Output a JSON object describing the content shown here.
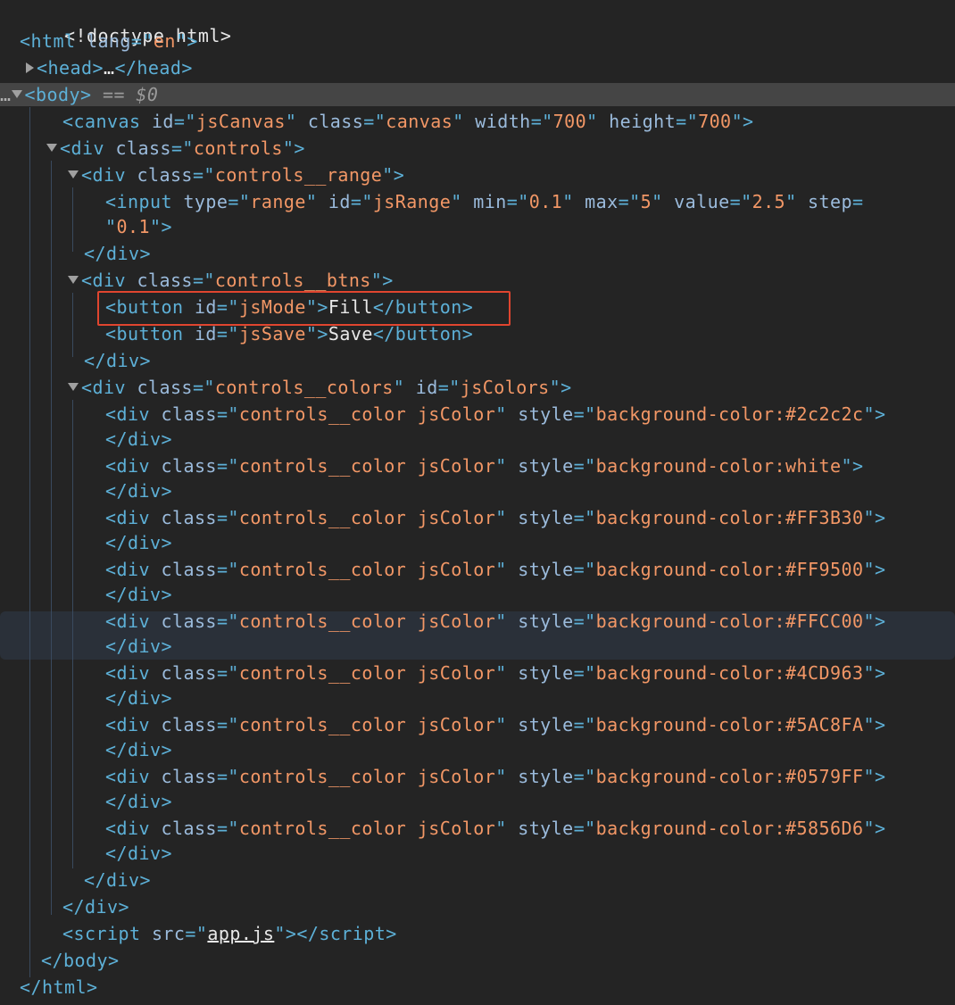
{
  "selected_suffix": "== $0",
  "lines": {
    "doctype": "<!doctype html>",
    "html_lang": "en",
    "head_ellipsis": "…",
    "canvas": {
      "id": "jsCanvas",
      "class": "canvas",
      "width": "700",
      "height": "700"
    },
    "controls_class": "controls",
    "range_class": "controls__range",
    "input": {
      "type": "range",
      "id": "jsRange",
      "min": "0.1",
      "max": "5",
      "value": "2.5",
      "step": "0.1"
    },
    "btns_class": "controls__btns",
    "mode_button": {
      "id": "jsMode",
      "text": "Fill"
    },
    "save_button": {
      "id": "jsSave",
      "text": "Save"
    },
    "colors_div": {
      "class": "controls__colors",
      "id": "jsColors"
    },
    "color_class": "controls__color jsColor",
    "script_src": "app.js"
  },
  "color_items": [
    {
      "style": "background-color:#2c2c2c"
    },
    {
      "style": "background-color:white"
    },
    {
      "style": "background-color:#FF3B30"
    },
    {
      "style": "background-color:#FF9500"
    },
    {
      "style": "background-color:#FFCC00"
    },
    {
      "style": "background-color:#4CD963"
    },
    {
      "style": "background-color:#5AC8FA"
    },
    {
      "style": "background-color:#0579FF"
    },
    {
      "style": "background-color:#5856D6"
    }
  ],
  "theme": {
    "background": "#242424",
    "tag_color": "#5db0d7",
    "attr_name_color": "#9bbbdc",
    "attr_value_color": "#f29766",
    "text_color": "#e8e8e8",
    "highlight_border": "#e0452f"
  }
}
